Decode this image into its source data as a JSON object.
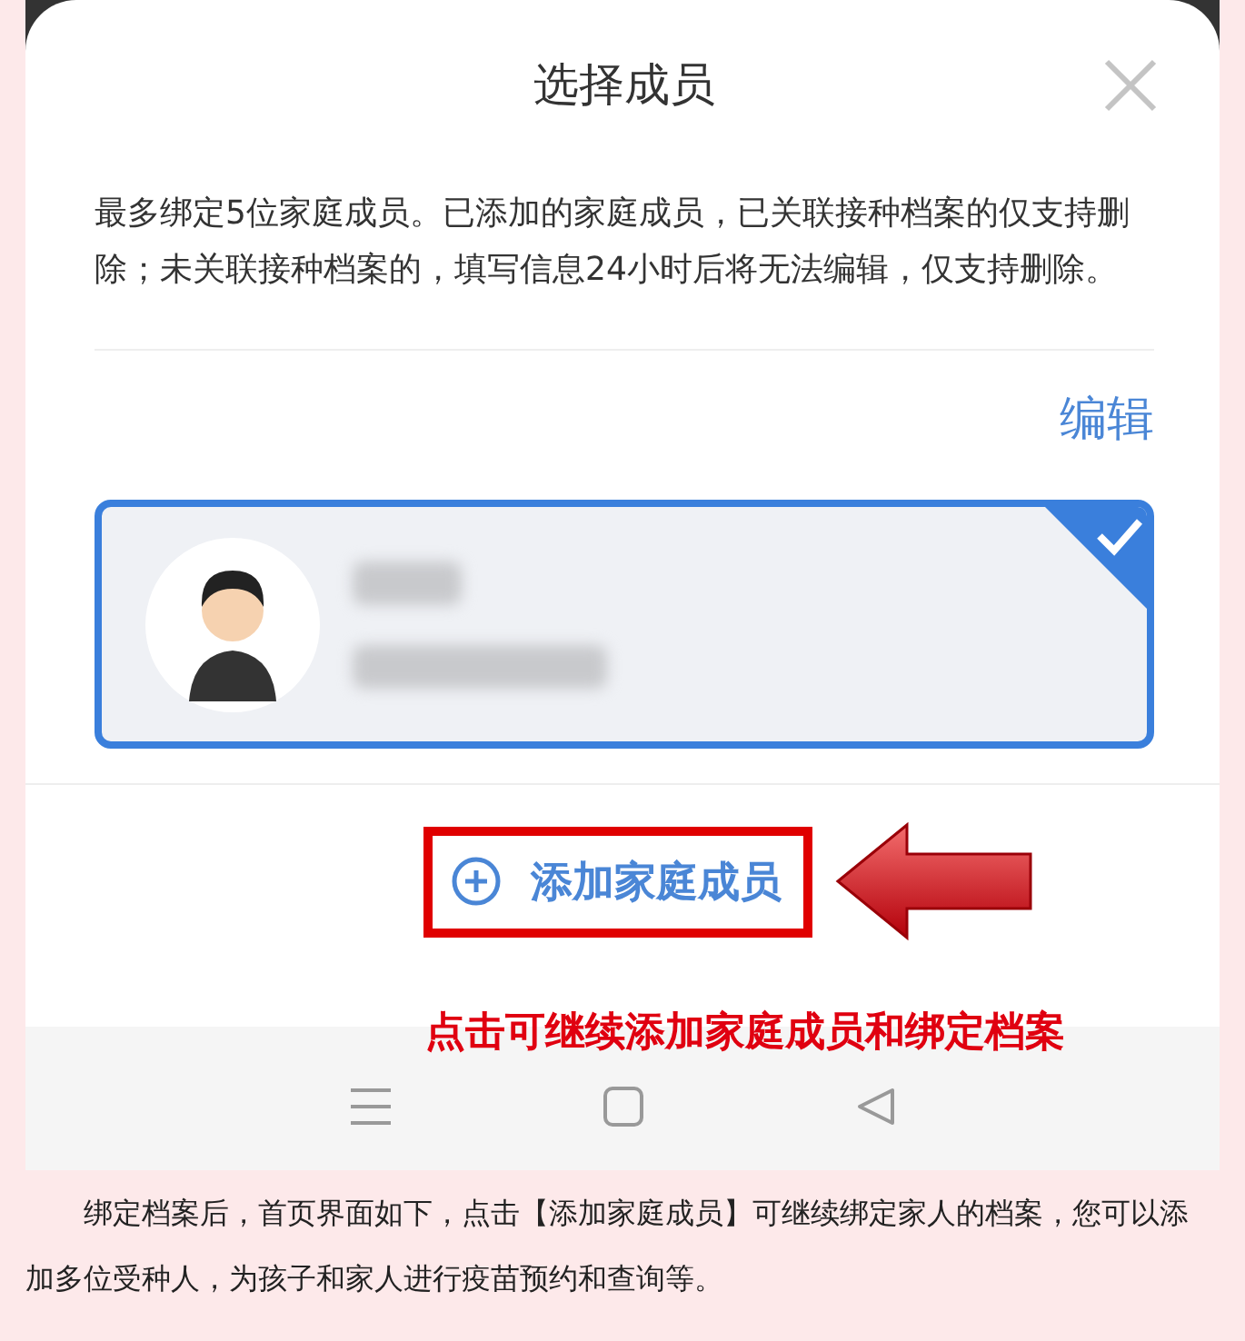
{
  "dialog": {
    "title": "选择成员",
    "notice": "最多绑定5位家庭成员。已添加的家庭成员，已关联接种档案的仅支持删除；未关联接种档案的，填写信息24小时后将无法编辑，仅支持删除。",
    "edit_link": "编辑",
    "members": [
      {
        "selected": true
      }
    ],
    "add_button": {
      "label": "添加家庭成员"
    }
  },
  "annotation": {
    "text": "点击可继续添加家庭成员和绑定档案"
  },
  "article": {
    "paragraph": "绑定档案后，首页界面如下，点击【添加家庭成员】可继续绑定家人的档案，您可以添加多位受种人，为孩子和家人进行疫苗预约和查询等。"
  }
}
